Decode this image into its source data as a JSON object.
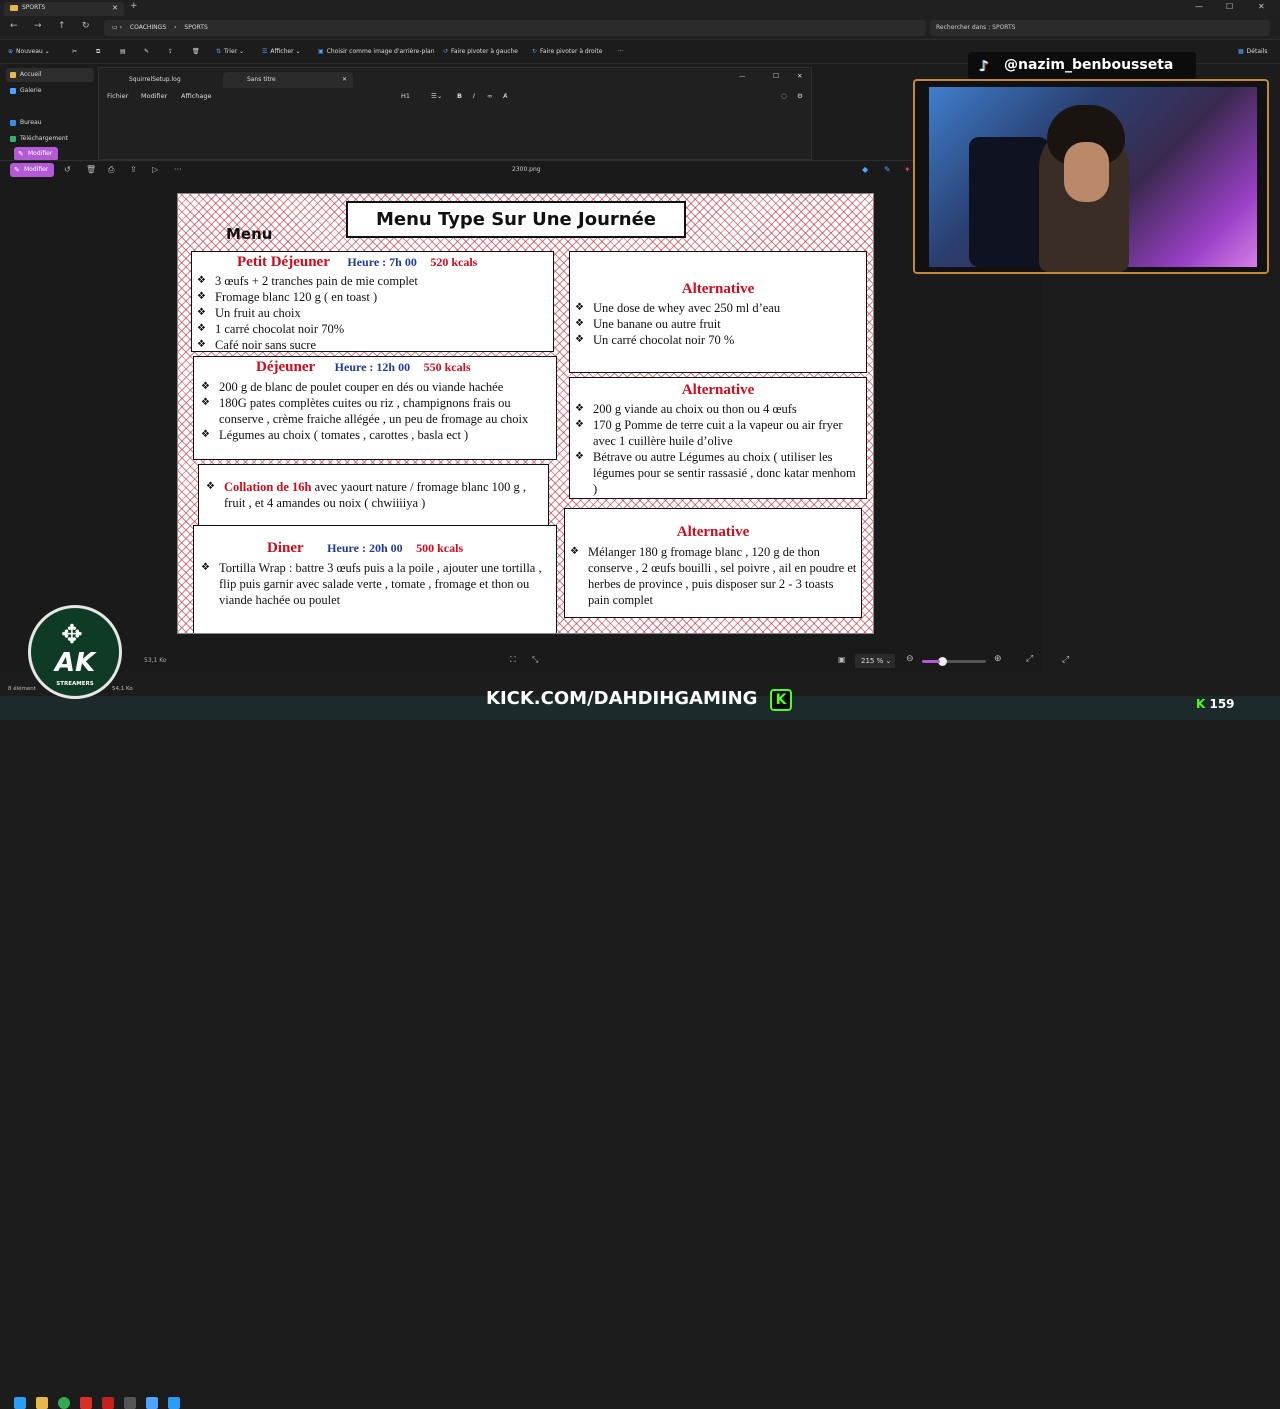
{
  "explorer": {
    "tab_title": "SPORTS",
    "breadcrumb": [
      "COACHINGS",
      "SPORTS"
    ],
    "search_placeholder": "Rechercher dans : SPORTS",
    "toolbar": {
      "new": "Nouveau",
      "sort": "Trier",
      "view": "Afficher",
      "set_bg": "Choisir comme image d'arrière-plan",
      "rotate_left": "Faire pivoter à gauche",
      "rotate_right": "Faire pivoter à droite",
      "details": "Détails"
    },
    "nav": [
      "Accueil",
      "Galerie",
      "Bureau",
      "Téléchargement"
    ],
    "status_items": "8 élément",
    "status_size": "54,1 Ko"
  },
  "notepad": {
    "tab1": "SquirrelSetup.log",
    "tab2": "Sans titre",
    "menu": [
      "Fichier",
      "Modifier",
      "Affichage"
    ],
    "heading": "H1",
    "edit_button": "Modifier"
  },
  "viewer": {
    "edit_button": "Modifier",
    "filename": "2300.png",
    "file_size": "53,1 Ko",
    "zoom": "215 %",
    "zoom_fraction": 0.28
  },
  "menu_image": {
    "title": "Menu Type Sur Une Journée",
    "menu_word": "Menu",
    "petit_dej": {
      "name": "Petit Déjeuner",
      "heure": "Heure : 7h 00",
      "kcal": "520 kcals",
      "items": [
        "3 œufs + 2 tranches pain de mie complet",
        "Fromage blanc 120 g ( en toast )",
        "Un fruit au choix",
        "1 carré chocolat noir 70%",
        "Café noir sans sucre"
      ]
    },
    "alt1": {
      "title": "Alternative",
      "items": [
        "Une dose de whey avec 250 ml d’eau",
        "Une banane ou autre fruit",
        "Un carré chocolat noir 70 %"
      ]
    },
    "dejeuner": {
      "name": "Déjeuner",
      "heure": "Heure : 12h 00",
      "kcal": "550 kcals",
      "items": [
        "200 g de blanc de poulet couper en dés ou viande hachée",
        "180G pates complètes cuites ou riz , champignons frais ou conserve , crème fraiche allégée , un peu de fromage au choix",
        "Légumes au choix ( tomates , carottes , basla ect )"
      ]
    },
    "alt2": {
      "title": "Alternative",
      "items": [
        "200 g viande au choix ou thon ou 4 œufs",
        "170 g Pomme de terre cuit a la vapeur ou air fryer avec 1 cuillère huile d’olive",
        "Bétrave ou autre Légumes au choix ( utiliser les légumes pour se sentir rassasié , donc katar menhom )"
      ]
    },
    "collation": {
      "lead": "Collation de 16h",
      "text": " avec yaourt nature / fromage blanc 100 g , fruit , et 4 amandes ou noix ( chwiiiiya )"
    },
    "diner": {
      "name": "Diner",
      "heure": "Heure : 20h 00",
      "kcal": "500 kcals",
      "items": [
        "Tortilla Wrap : battre 3 œufs puis a la poile , ajouter une tortilla , flip puis garnir avec salade verte , tomate , fromage et thon ou viande hachée ou poulet"
      ]
    },
    "alt3": {
      "title": "Alternative",
      "items": [
        "Mélanger 180 g fromage blanc , 120 g de thon conserve , 2 œufs bouilli , sel poivre , ail en poudre et herbes de province , puis disposer sur 2 - 3 toasts pain complet"
      ]
    }
  },
  "stream": {
    "tiktok_handle": "@nazim_benbousseta",
    "kick_url": "KICK.COM/DAHDIHGAMING",
    "kick_letter": "K",
    "viewers": "159",
    "logo_text": "AK",
    "logo_sub": "STREAMERS"
  },
  "colors": {
    "accent": "#b45ad6",
    "title_red": "#d40a1a",
    "time_blue": "#1f3a9e",
    "kick_green": "#53fc18"
  }
}
